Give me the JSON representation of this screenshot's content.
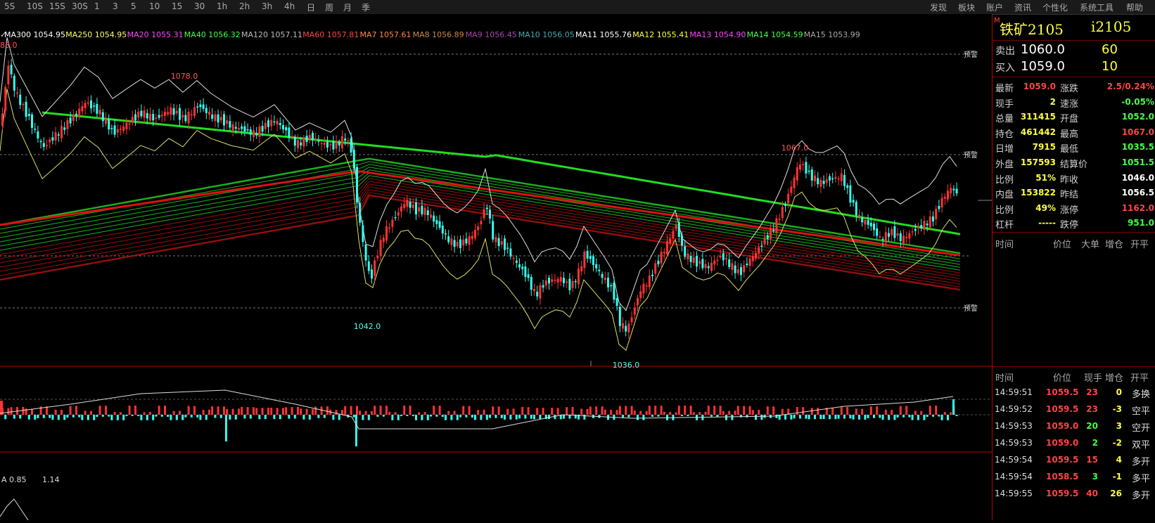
{
  "toolbar": {
    "items": [
      "5S",
      "10S",
      "15S",
      "30S",
      "1",
      "3",
      "5",
      "10",
      "15",
      "30",
      "1h",
      "2h",
      "3h",
      "4h",
      "日",
      "周",
      "月",
      "季"
    ],
    "right_items": [
      "发现",
      "板块",
      "账户",
      "资讯",
      "个性化",
      "系统工具",
      "帮助"
    ]
  },
  "ma_legend": [
    {
      "label": "MA300 1054.95",
      "color": "#ffffff"
    },
    {
      "label": "MA250 1054.95",
      "color": "#ffff66"
    },
    {
      "label": "MA20 1055.31",
      "color": "#ff44ff"
    },
    {
      "label": "MA40 1056.32",
      "color": "#44ff44"
    },
    {
      "label": "MA120 1057.11",
      "color": "#bbbbbb"
    },
    {
      "label": "MA60 1057.81",
      "color": "#ff4444"
    },
    {
      "label": "MA7 1057.61",
      "color": "#ff8844"
    },
    {
      "label": "MA8 1056.89",
      "color": "#cc8844"
    },
    {
      "label": "MA9 1056.45",
      "color": "#aa44aa"
    },
    {
      "label": "MA10 1056.05",
      "color": "#44aaaa"
    },
    {
      "label": "MA11 1055.76",
      "color": "#ffffff"
    },
    {
      "label": "MA12 1055.41",
      "color": "#ffff44"
    },
    {
      "label": "MA13 1054.90",
      "color": "#ff44ff"
    },
    {
      "label": "MA14 1054.59",
      "color": "#44ff44"
    },
    {
      "label": "MA15 1053.99",
      "color": "#aaaaaa"
    }
  ],
  "chart": {
    "price_labels": {
      "high": "1078.0",
      "low1": "1042.0",
      "low2": "1036.0",
      "right_high": "1067.0",
      "left_top": "83.0"
    },
    "alert_label": "预警",
    "indicator_label": "A 0.85",
    "indicator_value": "1.14"
  },
  "quote": {
    "symbol_mark": "M",
    "name": "铁矿2105",
    "code": "i2105",
    "sell_label": "卖出",
    "sell_price": "1060.0",
    "sell_vol": "60",
    "buy_label": "买入",
    "buy_price": "1059.0",
    "buy_vol": "10",
    "rows": [
      {
        "l1": "最新",
        "v1": "1059.0",
        "c1": "#ff4444",
        "l2": "涨跌",
        "v2": "2.5/0.24%",
        "c2": "#ff4444"
      },
      {
        "l1": "现手",
        "v1": "2",
        "c1": "#ffff44",
        "l2": "速涨",
        "v2": "-0.05%",
        "c2": "#44ff44"
      },
      {
        "l1": "总量",
        "v1": "311415",
        "c1": "#ffff44",
        "l2": "开盘",
        "v2": "1052.0",
        "c2": "#44ff44"
      },
      {
        "l1": "持仓",
        "v1": "461442",
        "c1": "#ffff44",
        "l2": "最高",
        "v2": "1067.0",
        "c2": "#ff4444"
      },
      {
        "l1": "日增",
        "v1": "7915",
        "c1": "#ffff44",
        "l2": "最低",
        "v2": "1035.5",
        "c2": "#44ff44"
      },
      {
        "l1": "外盘",
        "v1": "157593",
        "c1": "#ffff44",
        "l2": "结算价",
        "v2": "1051.5",
        "c2": "#44ff44"
      },
      {
        "l1": "比例",
        "v1": "51%",
        "c1": "#ffff44",
        "l2": "昨收",
        "v2": "1046.0",
        "c2": "#ffffff"
      },
      {
        "l1": "内盘",
        "v1": "153822",
        "c1": "#ffff44",
        "l2": "昨结",
        "v2": "1056.5",
        "c2": "#ffffff"
      },
      {
        "l1": "比例",
        "v1": "49%",
        "c1": "#ffff44",
        "l2": "涨停",
        "v2": "1162.0",
        "c2": "#ff4444"
      },
      {
        "l1": "杠杆",
        "v1": "-----",
        "c1": "#ffff44",
        "l2": "跌停",
        "v2": "951.0",
        "c2": "#44ff44"
      }
    ],
    "tick_header": [
      "时间",
      "价位",
      "大单",
      "增仓",
      "开平"
    ],
    "trade_header": [
      "时间",
      "价位",
      "现手",
      "增仓",
      "开平"
    ],
    "trades": [
      {
        "time": "14:59:51",
        "price": "1059.5",
        "pc": "#ff4444",
        "vol": "23",
        "vc": "#ff4444",
        "chg": "0",
        "type": "多换"
      },
      {
        "time": "14:59:52",
        "price": "1059.5",
        "pc": "#ff4444",
        "vol": "23",
        "vc": "#ff4444",
        "chg": "-3",
        "type": "空平"
      },
      {
        "time": "14:59:53",
        "price": "1059.0",
        "pc": "#ff4444",
        "vol": "20",
        "vc": "#44ff44",
        "chg": "3",
        "type": "空开"
      },
      {
        "time": "14:59:53",
        "price": "1059.0",
        "pc": "#ff4444",
        "vol": "2",
        "vc": "#44ff44",
        "chg": "-2",
        "type": "双平"
      },
      {
        "time": "14:59:54",
        "price": "1059.5",
        "pc": "#ff4444",
        "vol": "15",
        "vc": "#ff4444",
        "chg": "4",
        "type": "多开"
      },
      {
        "time": "14:59:54",
        "price": "1058.5",
        "pc": "#ff4444",
        "vol": "3",
        "vc": "#44ff44",
        "chg": "-1",
        "type": "多平"
      },
      {
        "time": "14:59:55",
        "price": "1059.5",
        "pc": "#ff4444",
        "vol": "40",
        "vc": "#ff4444",
        "chg": "26",
        "type": "多开"
      }
    ]
  },
  "colors": {
    "up": "#ff3333",
    "down": "#33ffee",
    "ma_green": "#22cc22",
    "ma_red": "#cc1111",
    "accent": "#b00000"
  }
}
